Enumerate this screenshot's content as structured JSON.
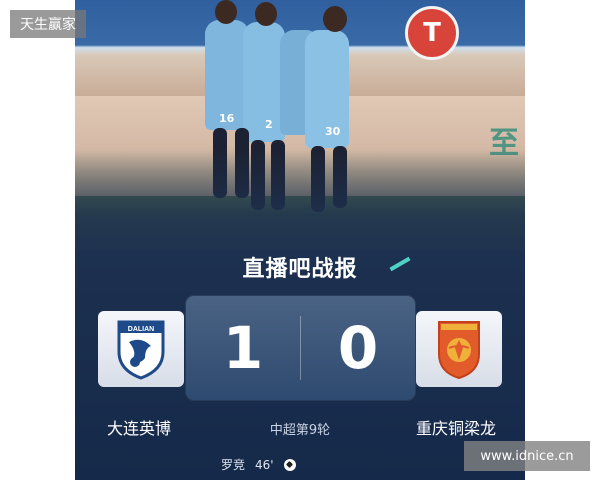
{
  "watermarks": {
    "top_left": "天生赢家",
    "bottom_right": "www.idnice.cn"
  },
  "photo": {
    "stadium_logo_text": "T",
    "ad_board_text": "至",
    "jersey_numbers": [
      "16",
      "2",
      "30"
    ]
  },
  "report": {
    "title": "直播吧战报",
    "round": "中超第9轮"
  },
  "match": {
    "home": {
      "name": "大连英博",
      "score": "1",
      "badge_text": "DALIAN",
      "badge_color": "#1f4a8a"
    },
    "away": {
      "name": "重庆铜梁龙",
      "score": "0",
      "badge_color": "#e25b2b"
    }
  },
  "goals": [
    {
      "player": "罗竞",
      "minute": "46'"
    }
  ],
  "colors": {
    "card_background": "#1e3150",
    "score_box": "#3d5779",
    "accent": "#4fd1c5"
  }
}
